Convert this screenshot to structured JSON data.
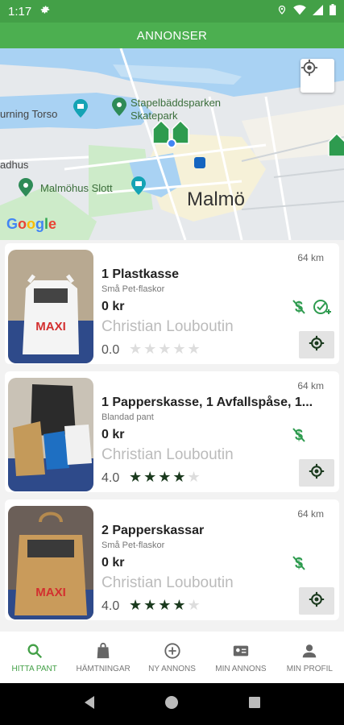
{
  "status_bar": {
    "time": "1:17"
  },
  "app_bar": {
    "title": "ANNONSER"
  },
  "map": {
    "labels": [
      "urning Torso",
      "Stapelbäddsparken",
      "Skatepark",
      "adhus",
      "Malmöhus Slott"
    ],
    "city": "Malmö",
    "attribution": "Google"
  },
  "listings": [
    {
      "title": "1 Plastkasse",
      "category": "Små Pet-flaskor",
      "price": "0 kr",
      "owner": "Christian Louboutin",
      "rating": "0.0",
      "stars": 0,
      "distance": "64 km",
      "photo": "maxi-bag-plastic"
    },
    {
      "title": "1 Papperskasse, 1 Avfallspåse, 1...",
      "category": "Blandad pant",
      "price": "0 kr",
      "owner": "Christian Louboutin",
      "rating": "4.0",
      "stars": 4,
      "distance": "64 km",
      "photo": "mixed-bags"
    },
    {
      "title": "2 Papperskassar",
      "category": "Små Pet-flaskor",
      "price": "0 kr",
      "owner": "Christian Louboutin",
      "rating": "4.0",
      "stars": 4,
      "distance": "64 km",
      "photo": "maxi-bag-paper"
    }
  ],
  "bottom_nav": [
    {
      "label": "HITTA PANT",
      "icon": "search-icon",
      "active": true
    },
    {
      "label": "HÄMTNINGAR",
      "icon": "bag-icon",
      "active": false
    },
    {
      "label": "NY ANNONS",
      "icon": "add-circle-icon",
      "active": false
    },
    {
      "label": "MIN ANNONS",
      "icon": "id-card-icon",
      "active": false
    },
    {
      "label": "MIN PROFIL",
      "icon": "person-icon",
      "active": false
    }
  ],
  "colors": {
    "primary": "#4caf50",
    "status": "#43a047",
    "star": "#1b3a1e"
  }
}
